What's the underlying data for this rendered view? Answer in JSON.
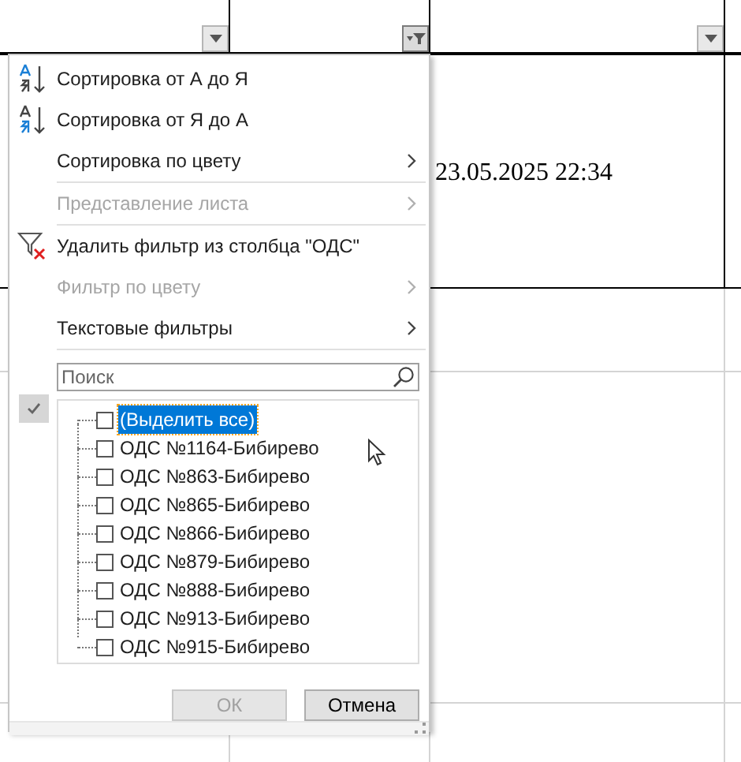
{
  "header_columns": [
    {
      "filter_active": false
    },
    {
      "filter_active": true
    },
    {
      "filter_active": false
    }
  ],
  "row": {
    "column_3": "23.05.2025 22:34"
  },
  "menu": {
    "items": [
      {
        "kind": "sort_asc",
        "label": "Сортировка от А до Я",
        "disabled": false,
        "separator_after": false
      },
      {
        "kind": "sort_desc",
        "label": "Сортировка от Я до А",
        "disabled": false,
        "separator_after": false
      },
      {
        "kind": "submenu",
        "label": "Сортировка по цвету",
        "disabled": false,
        "separator_after": true
      },
      {
        "kind": "submenu",
        "label": "Представление листа",
        "disabled": true,
        "separator_after": true
      },
      {
        "kind": "clear_filter",
        "label": "Удалить фильтр из столбца \"ОДС\"",
        "disabled": false,
        "separator_after": false
      },
      {
        "kind": "submenu",
        "label": "Фильтр по цвету",
        "disabled": true,
        "separator_after": false
      },
      {
        "kind": "submenu",
        "label": "Текстовые фильтры",
        "disabled": false,
        "separator_after": true
      }
    ],
    "search": {
      "placeholder": "Поиск"
    },
    "select_all": {
      "label": "(Выделить все)",
      "checked": false,
      "selected": true
    },
    "values": [
      {
        "label": "ОДС №1164-Бибирево",
        "checked": false,
        "selected": false
      },
      {
        "label": "ОДС №863-Бибирево",
        "checked": false,
        "selected": false
      },
      {
        "label": "ОДС №865-Бибирево",
        "checked": false,
        "selected": false
      },
      {
        "label": "ОДС №866-Бибирево",
        "checked": false,
        "selected": false
      },
      {
        "label": "ОДС №879-Бибирево",
        "checked": false,
        "selected": false
      },
      {
        "label": "ОДС №888-Бибирево",
        "checked": false,
        "selected": false
      },
      {
        "label": "ОДС №913-Бибирево",
        "checked": false,
        "selected": false
      },
      {
        "label": "ОДС №915-Бибирево",
        "checked": false,
        "selected": false
      }
    ],
    "buttons": [
      {
        "label": "ОК",
        "disabled": true
      },
      {
        "label": "Отмена",
        "disabled": false
      }
    ]
  }
}
